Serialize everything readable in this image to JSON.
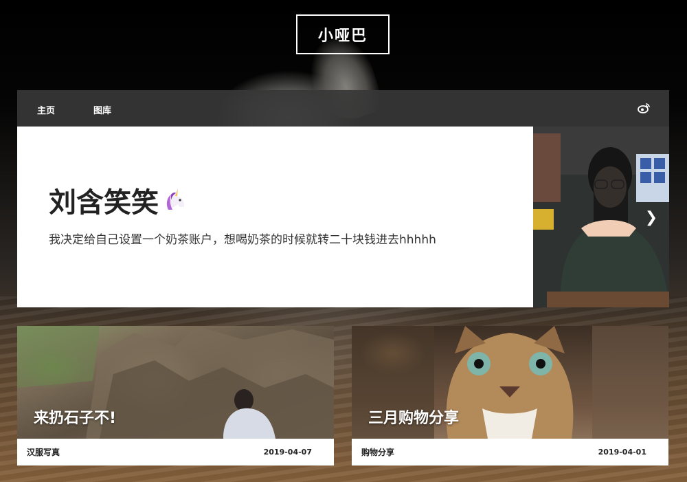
{
  "site": {
    "title": "小哑巴"
  },
  "nav": {
    "items": [
      {
        "label": "主页"
      },
      {
        "label": "图库"
      }
    ],
    "social_icon": "weibo-icon"
  },
  "hero": {
    "title": "刘含笑笑",
    "title_emoji": "unicorn-icon",
    "description": "我决定给自己设置一个奶茶账户，想喝奶茶的时候就转二十块钱进去hhhhh",
    "next_icon": "chevron-right-icon"
  },
  "cards": [
    {
      "caption": "来扔石子不!",
      "category": "汉服写真",
      "date": "2019-04-07"
    },
    {
      "caption": "三月购物分享",
      "category": "购物分享",
      "date": "2019-04-01"
    }
  ]
}
